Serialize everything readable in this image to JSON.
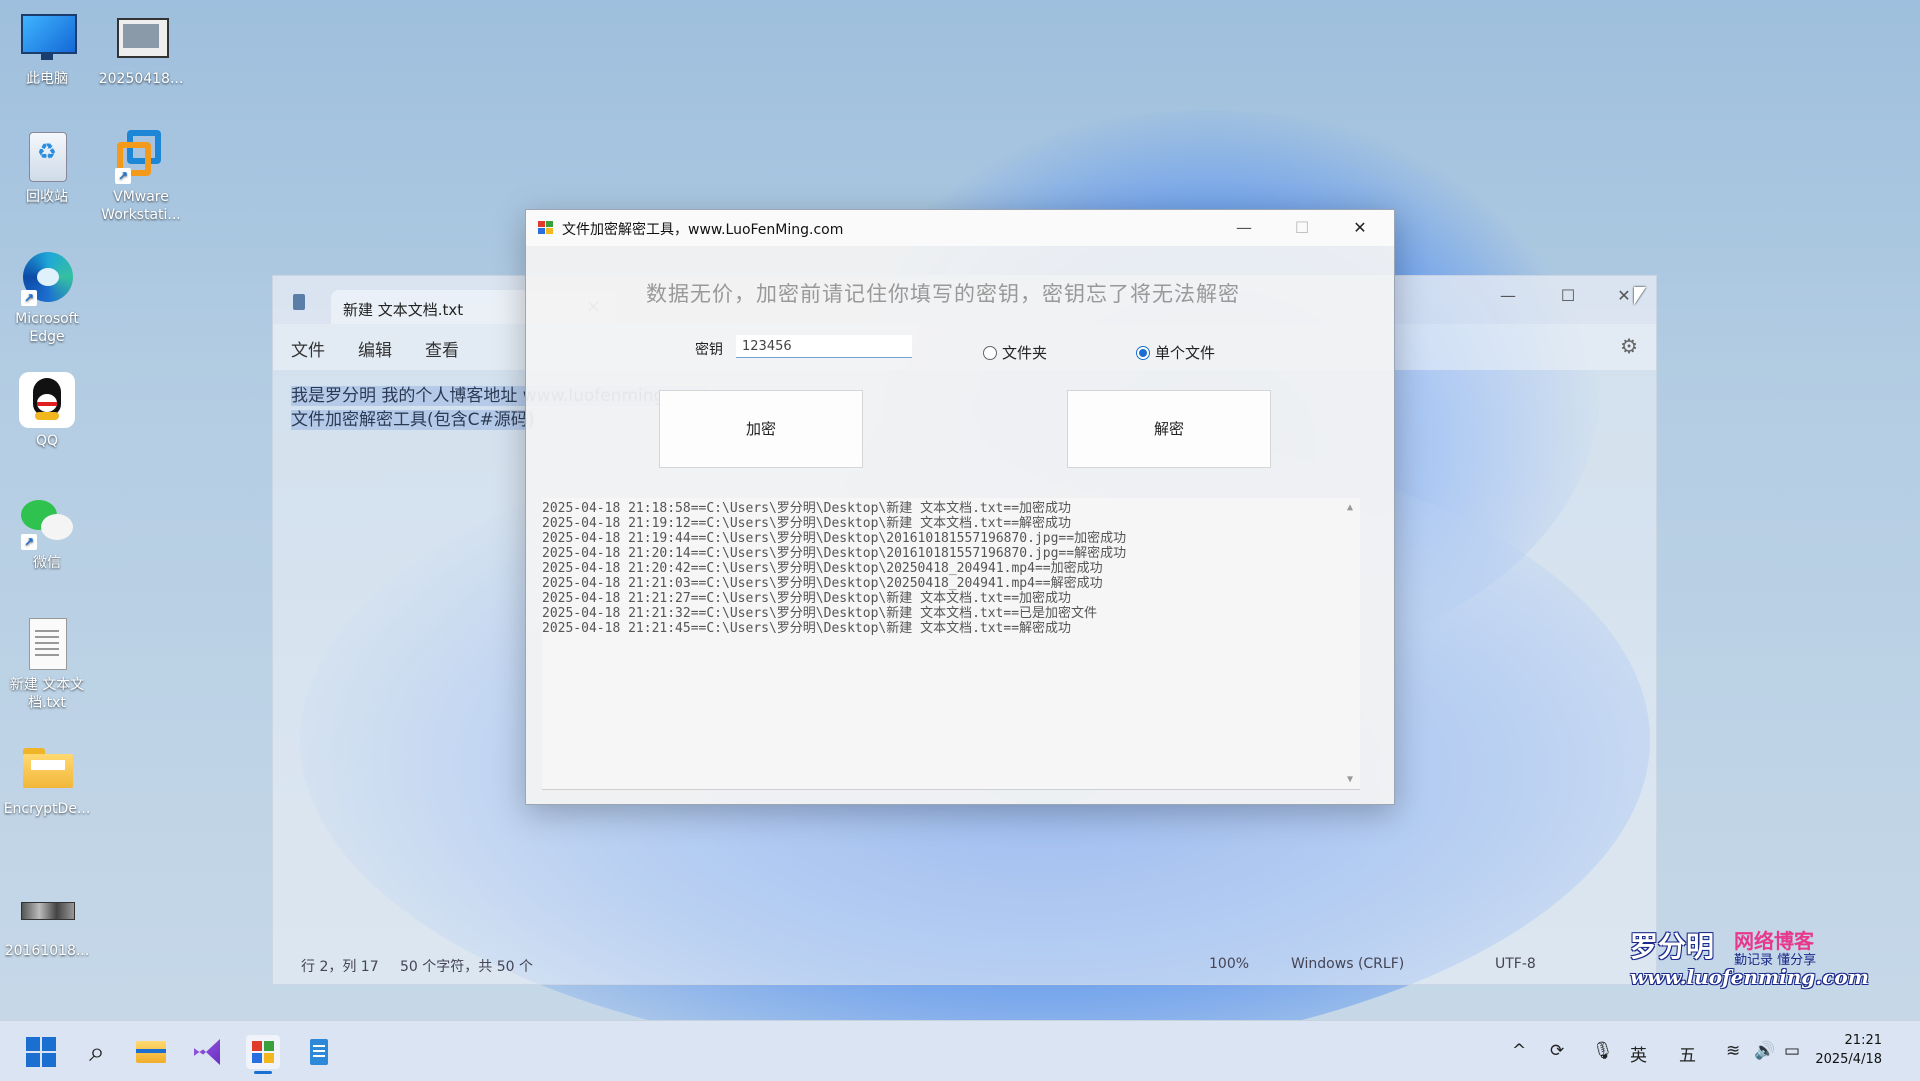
{
  "desktop": {
    "icons": [
      {
        "label": "此电脑",
        "icon": "monitor-icon"
      },
      {
        "label": "20250418...",
        "icon": "video-file-icon"
      },
      {
        "label": "回收站",
        "icon": "recycle-bin-icon"
      },
      {
        "label": "VMware Workstati...",
        "icon": "vmware-icon"
      },
      {
        "label": "Microsoft Edge",
        "icon": "edge-icon"
      },
      {
        "label": "QQ",
        "icon": "qq-icon"
      },
      {
        "label": "微信",
        "icon": "wechat-icon"
      },
      {
        "label": "新建 文本文 档.txt",
        "icon": "text-file-icon"
      },
      {
        "label": "EncryptDe...",
        "icon": "folder-icon"
      },
      {
        "label": "20161018...",
        "icon": "image-file-icon"
      }
    ]
  },
  "notepad": {
    "tab_title": "新建 文本文档.txt",
    "menu": [
      "文件",
      "编辑",
      "查看"
    ],
    "lines": [
      "我是罗分明 我的个人博客地址 www.luofenming.com",
      "文件加密解密工具(包含C#源码)"
    ],
    "status": {
      "position": "行 2，列 17",
      "chars": "50 个字符，共 50 个",
      "zoom": "100%",
      "line_ending": "Windows (CRLF)",
      "encoding": "UTF-8"
    }
  },
  "encrypt_window": {
    "title": "文件加密解密工具，www.LuoFenMing.com",
    "warning": "数据无价，加密前请记住你填写的密钥，密钥忘了将无法解密",
    "key_label": "密钥",
    "key_value": "123456",
    "radio_folder": "文件夹",
    "radio_single": "单个文件",
    "selected_mode": "单个文件",
    "encrypt_button": "加密",
    "decrypt_button": "解密",
    "log": [
      "2025-04-18 21:18:58==C:\\Users\\罗分明\\Desktop\\新建 文本文档.txt==加密成功",
      "2025-04-18 21:19:12==C:\\Users\\罗分明\\Desktop\\新建 文本文档.txt==解密成功",
      "2025-04-18 21:19:44==C:\\Users\\罗分明\\Desktop\\201610181557196870.jpg==加密成功",
      "2025-04-18 21:20:14==C:\\Users\\罗分明\\Desktop\\201610181557196870.jpg==解密成功",
      "2025-04-18 21:20:42==C:\\Users\\罗分明\\Desktop\\20250418_204941.mp4==加密成功",
      "2025-04-18 21:21:03==C:\\Users\\罗分明\\Desktop\\20250418_204941.mp4==解密成功",
      "2025-04-18 21:21:27==C:\\Users\\罗分明\\Desktop\\新建 文本文档.txt==加密成功",
      "2025-04-18 21:21:32==C:\\Users\\罗分明\\Desktop\\新建 文本文档.txt==已是加密文件",
      "2025-04-18 21:21:45==C:\\Users\\罗分明\\Desktop\\新建 文本文档.txt==解密成功"
    ]
  },
  "watermark": {
    "name": "罗分明",
    "tagline": "网络博客",
    "sub": "勤记录 懂分享",
    "site": "www.luofenming.com"
  },
  "taskbar": {
    "tray_ime_lang": "英",
    "tray_ime_mode": "五",
    "time": "21:21",
    "date": "2025/4/18"
  },
  "colors": {
    "accent": "#1a6fd1",
    "wallpaper": "#a9c4de"
  }
}
